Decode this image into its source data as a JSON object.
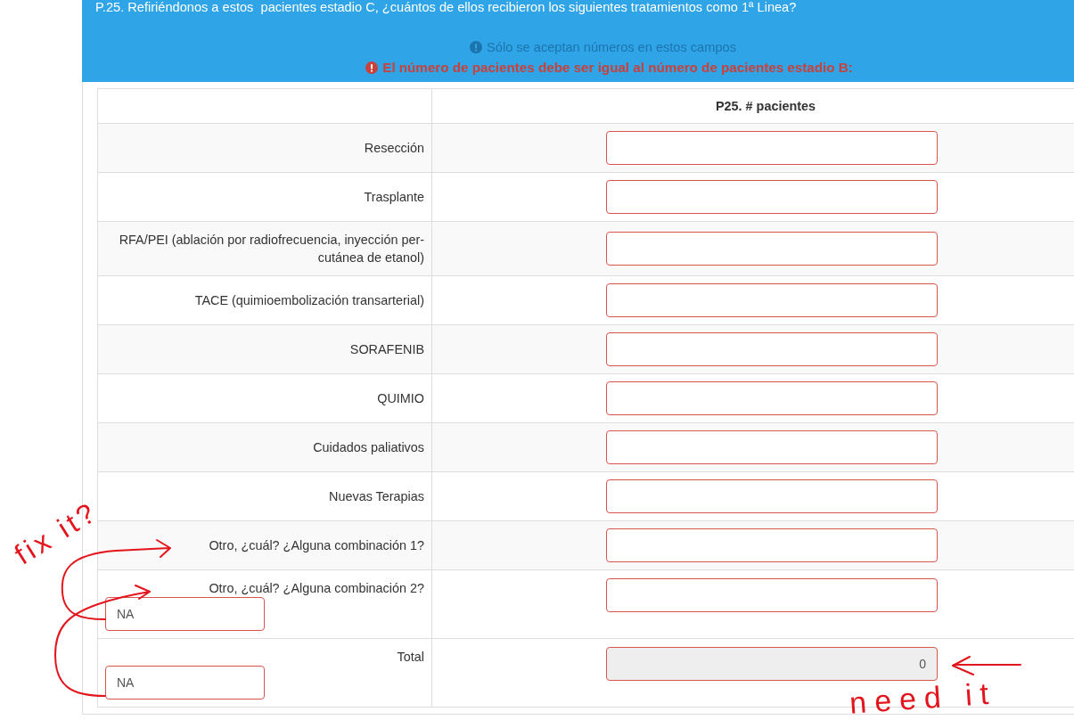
{
  "question": {
    "text": "P.25. Refiriéndonos a estos  pacientes estadio C, ¿cuántos de ellos recibieron los siguientes tratamientos como 1ª Linea?",
    "hint": "Sólo se aceptan números en estos campos",
    "error": "El número de pacientes debe ser igual al número de pacientes estadio B:"
  },
  "table": {
    "header": "P25. # pacientes",
    "rows": [
      {
        "label": "Resección",
        "invalid": true
      },
      {
        "label": "Trasplante",
        "invalid": true
      },
      {
        "label": "RFA/PEI (ablación por radiofrecuencia, inyección per-cutánea de etanol)",
        "invalid": true
      },
      {
        "label": "TACE (quimioembolización transarterial)",
        "invalid": true
      },
      {
        "label": "SORAFENIB",
        "invalid": true
      },
      {
        "label": "QUIMIO",
        "invalid": true
      },
      {
        "label": "Cuidados paliativos",
        "invalid": true
      },
      {
        "label": "Nuevas Terapias",
        "invalid": true
      },
      {
        "label": "Otro, ¿cuál? ¿Alguna combinación 1?",
        "invalid": true
      },
      {
        "label": "Otro, ¿cuál? ¿Alguna combinación 2?",
        "invalid": true,
        "other_field": {
          "value": "NA",
          "invalid": true
        }
      }
    ],
    "total": {
      "label": "Total",
      "value": "0",
      "disabled": true,
      "invalid": true,
      "other_field": {
        "value": "NA",
        "invalid": true
      }
    }
  },
  "handwritten_notes": [
    "fix it?",
    "need it"
  ]
}
